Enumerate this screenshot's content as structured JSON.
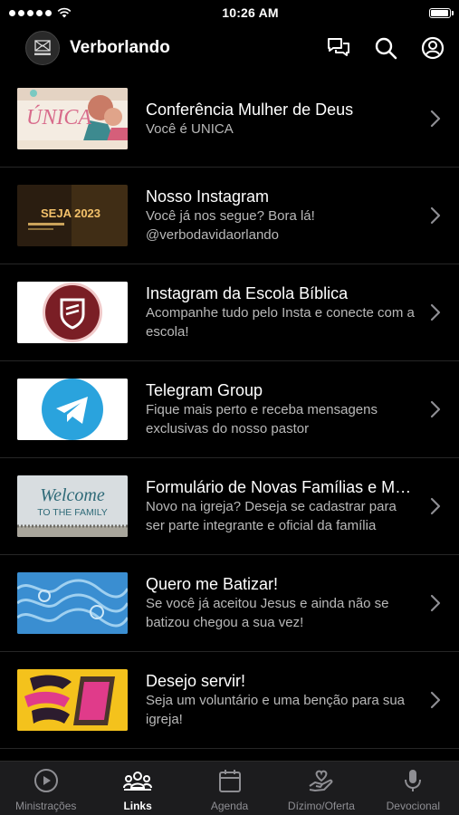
{
  "status": {
    "time": "10:26 AM"
  },
  "header": {
    "title": "Verborlando",
    "icons": [
      "chat-icon",
      "search-icon",
      "profile-icon"
    ]
  },
  "links": [
    {
      "title": "Conferência Mulher de Deus",
      "subtitle": "Você é UNICA",
      "thumb_label": "ÚNICA"
    },
    {
      "title": "Nosso Instagram",
      "subtitle": "Você já nos segue? Bora lá! @verbodavidaorlando",
      "thumb_label": "SEJA 2023"
    },
    {
      "title": "Instagram da Escola Bíblica",
      "subtitle": "Acompanhe tudo pelo Insta e conecte com a escola!"
    },
    {
      "title": "Telegram Group",
      "subtitle": "Fique mais perto e receba mensagens exclusivas do nosso pastor"
    },
    {
      "title": "Formulário de Novas Famílias e Membros",
      "subtitle": "Novo na igreja? Deseja se cadastrar para ser parte integrante e oficial da família",
      "thumb_line1": "Welcome",
      "thumb_line2": "TO THE FAMILY"
    },
    {
      "title": "Quero me Batizar!",
      "subtitle": "Se você já aceitou Jesus e ainda não se batizou chegou a sua vez!"
    },
    {
      "title": "Desejo servir!",
      "subtitle": "Seja um voluntário e uma benção para sua igreja!"
    }
  ],
  "tabs": [
    {
      "label": "Ministrações",
      "icon": "play-icon"
    },
    {
      "label": "Links",
      "icon": "group-icon",
      "active": true
    },
    {
      "label": "Agenda",
      "icon": "calendar-icon"
    },
    {
      "label": "Dízimo/Oferta",
      "icon": "donate-icon"
    },
    {
      "label": "Devocional",
      "icon": "microphone-icon"
    }
  ]
}
